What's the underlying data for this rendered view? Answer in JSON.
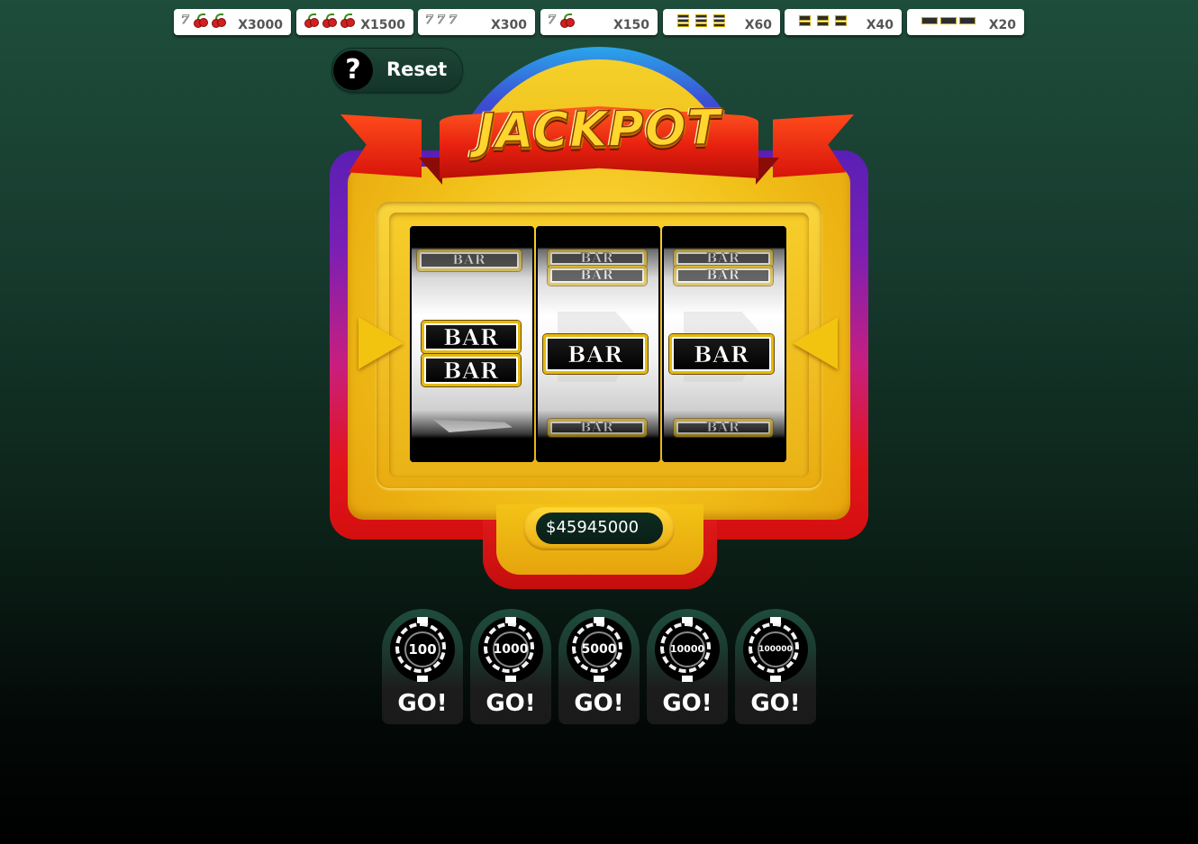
{
  "paytable": [
    {
      "symbols": [
        "seven",
        "cherry",
        "cherry"
      ],
      "multiplier": "X3000"
    },
    {
      "symbols": [
        "cherry",
        "cherry",
        "cherry"
      ],
      "multiplier": "X1500"
    },
    {
      "symbols": [
        "seven",
        "seven",
        "seven"
      ],
      "multiplier": "X300"
    },
    {
      "symbols": [
        "seven",
        "cherry"
      ],
      "multiplier": "X150"
    },
    {
      "symbols": [
        "triple-bar",
        "triple-bar",
        "triple-bar"
      ],
      "multiplier": "X60"
    },
    {
      "symbols": [
        "double-bar",
        "double-bar",
        "double-bar"
      ],
      "multiplier": "X40"
    },
    {
      "symbols": [
        "single-bar",
        "single-bar",
        "single-bar"
      ],
      "multiplier": "X20"
    }
  ],
  "header": {
    "help_icon": "?",
    "reset_label": "Reset"
  },
  "machine": {
    "title": "JACKPOT",
    "bar_label": "BAR",
    "balance": "$45945000",
    "reels": [
      {
        "top": "single-bar",
        "center": "double-bar",
        "bottom": "seven"
      },
      {
        "top": "double-bar",
        "center": "single-bar",
        "bottom": "single-bar"
      },
      {
        "top": "double-bar",
        "center": "single-bar",
        "bottom": "single-bar"
      }
    ]
  },
  "bets": [
    {
      "value": "100",
      "go_label": "GO!"
    },
    {
      "value": "1000",
      "go_label": "GO!"
    },
    {
      "value": "5000",
      "go_label": "GO!"
    },
    {
      "value": "10000",
      "go_label": "GO!"
    },
    {
      "value": "100000",
      "go_label": "GO!"
    }
  ],
  "colors": {
    "background_top": "#1e4d3b",
    "cabinet_yellow": "#f2c11a",
    "cabinet_red": "#e2141c",
    "arch_blue": "#2aa6ea",
    "bar_gold": "#e3b90f"
  }
}
